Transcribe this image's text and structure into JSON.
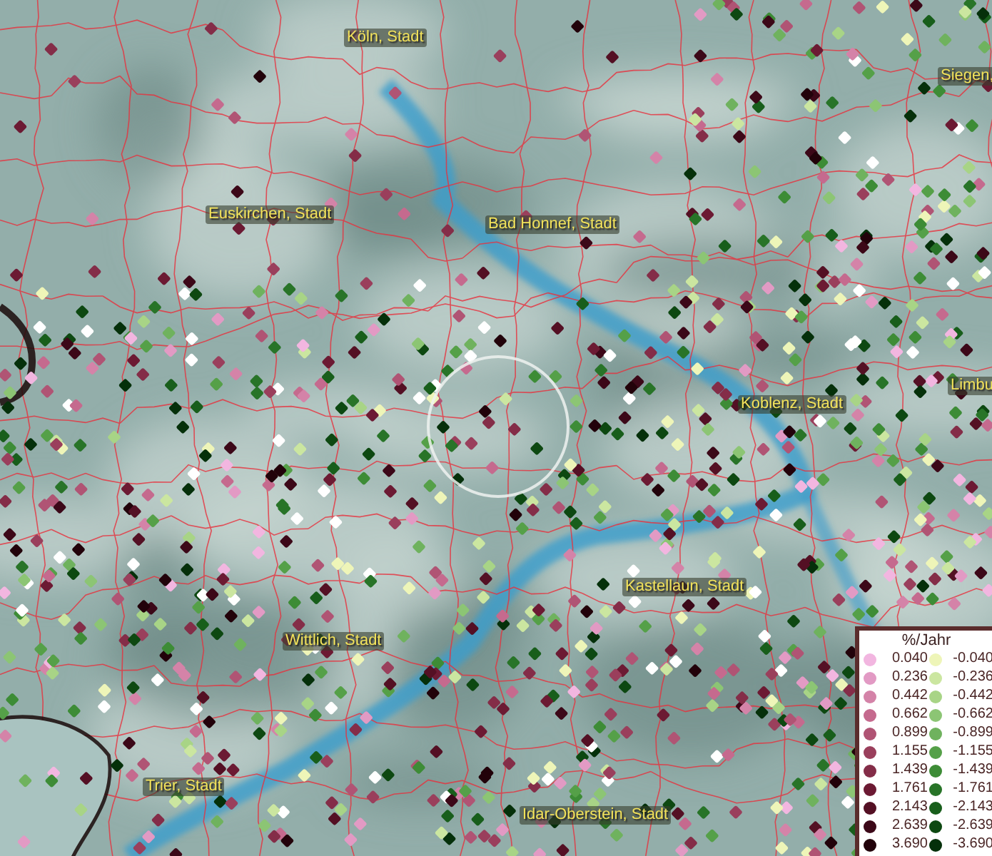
{
  "map": {
    "places": [
      {
        "name": "Köln, Stadt"
      },
      {
        "name": "Siegen,"
      },
      {
        "name": "Euskirchen, Stadt"
      },
      {
        "name": "Bad Honnef, Stadt"
      },
      {
        "name": "Koblenz, Stadt"
      },
      {
        "name": "Limbu"
      },
      {
        "name": "Kastellaun, Stadt"
      },
      {
        "name": "Wittlich, Stadt"
      },
      {
        "name": "Trier, Stadt"
      },
      {
        "name": "Idar-Oberstein, Stadt"
      }
    ]
  },
  "legend": {
    "title": "%/Jahr",
    "positive": [
      {
        "value": "0.040",
        "color": "#f2b6e0"
      },
      {
        "value": "0.236",
        "color": "#e29ac4"
      },
      {
        "value": "0.442",
        "color": "#d483a8"
      },
      {
        "value": "0.662",
        "color": "#c56a8e"
      },
      {
        "value": "0.899",
        "color": "#b05474"
      },
      {
        "value": "1.155",
        "color": "#9a3f5c"
      },
      {
        "value": "1.439",
        "color": "#842d48"
      },
      {
        "value": "1.761",
        "color": "#6c1a33"
      },
      {
        "value": "2.143",
        "color": "#541024"
      },
      {
        "value": "2.639",
        "color": "#3c0818"
      },
      {
        "value": "3.690",
        "color": "#22020a"
      }
    ],
    "negative": [
      {
        "value": "-0.040",
        "color": "#eef5b8"
      },
      {
        "value": "-0.236",
        "color": "#cbe6a0"
      },
      {
        "value": "-0.442",
        "color": "#a8d486"
      },
      {
        "value": "-0.662",
        "color": "#8cc574"
      },
      {
        "value": "-0.899",
        "color": "#6fb25e"
      },
      {
        "value": "-1.155",
        "color": "#55a048"
      },
      {
        "value": "-1.439",
        "color": "#3d8c36"
      },
      {
        "value": "-1.761",
        "color": "#287428"
      },
      {
        "value": "-2.143",
        "color": "#185e1b"
      },
      {
        "value": "-2.639",
        "color": "#0d4811"
      },
      {
        "value": "-3.690",
        "color": "#05300a"
      }
    ]
  }
}
